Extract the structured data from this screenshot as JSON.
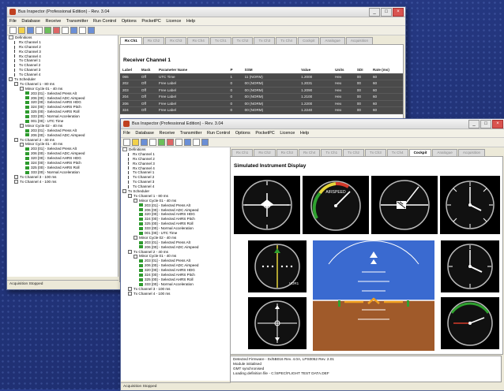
{
  "app_title": "Bus Inspector (Professional Edition) - Rev. 3.04",
  "menu": [
    "File",
    "Database",
    "Receive",
    "Transmitter",
    "Run Control",
    "Options",
    "PocketPC",
    "Licence",
    "Help"
  ],
  "tabs": [
    "Rx Ch1",
    "Rx Ch2",
    "Rx Ch3",
    "Rx Ch4",
    "Tx Ch1",
    "Tx Ch2",
    "Tx Ch3",
    "Tx Ch4",
    "Cockpit",
    "Analogue",
    "Acquisition"
  ],
  "back_window": {
    "receiver_heading": "Receiver Channel 1",
    "columns": [
      "Label",
      "Mask",
      "Parameter Name",
      "P",
      "SSM",
      "Value",
      "Units",
      "SDI",
      "Rate (ms)"
    ],
    "rows": [
      [
        "065",
        "Off",
        "UTC Time",
        "1",
        "11 (NORM)",
        "1.2000",
        "Hex",
        "00",
        "60"
      ],
      [
        "202",
        "Off",
        "Free Label",
        "0",
        "00 (NORM)",
        "1.2031",
        "Hex",
        "00",
        "60"
      ],
      [
        "203",
        "Off",
        "Free Label",
        "0",
        "00 (NORM)",
        "1.2090",
        "Hex",
        "00",
        "60"
      ],
      [
        "204",
        "Off",
        "Free Label",
        "0",
        "00 (NORM)",
        "1.2100",
        "Hex",
        "00",
        "60"
      ],
      [
        "206",
        "Off",
        "Free Label",
        "0",
        "00 (NORM)",
        "1.2200",
        "Hex",
        "00",
        "60"
      ],
      [
        "324",
        "Off",
        "Free Label",
        "0",
        "00 (NORM)",
        "1.2240",
        "Hex",
        "00",
        "60"
      ]
    ],
    "status": "Acquisition Stopped"
  },
  "tree": [
    {
      "level": 0,
      "icon": "doc",
      "label": "Definitions"
    },
    {
      "level": 1,
      "icon": "ant",
      "label": "Rx Channel 1"
    },
    {
      "level": 1,
      "icon": "ant",
      "label": "Rx Channel 2"
    },
    {
      "level": 1,
      "icon": "ant",
      "label": "Rx Channel 3"
    },
    {
      "level": 1,
      "icon": "ant",
      "label": "Rx Channel 4"
    },
    {
      "level": 1,
      "icon": "ant",
      "label": "Tx Channel 1"
    },
    {
      "level": 1,
      "icon": "ant",
      "label": "Tx Channel 2"
    },
    {
      "level": 1,
      "icon": "ant",
      "label": "Tx Channel 3"
    },
    {
      "level": 1,
      "icon": "ant",
      "label": "Tx Channel 4"
    },
    {
      "level": 0,
      "icon": "box",
      "label": "Tx Scheduler"
    },
    {
      "level": 1,
      "icon": "box",
      "label": "Tx Channel 1 - 80 ms"
    },
    {
      "level": 2,
      "icon": "box",
      "label": "Minor Cycle 01 - 40 ms"
    },
    {
      "level": 3,
      "icon": "grn",
      "label": "203 [01] - Selected Press Alt"
    },
    {
      "level": 3,
      "icon": "grn",
      "label": "206 [00] - Selected ADC Airspeed"
    },
    {
      "level": 3,
      "icon": "grn",
      "label": "320 [00] - Selected AHRS HDG"
    },
    {
      "level": 3,
      "icon": "grn",
      "label": "324 [00] - Selected AHRS Pitch"
    },
    {
      "level": 3,
      "icon": "grn",
      "label": "325 [00] - Selected AHRS Roll"
    },
    {
      "level": 3,
      "icon": "grn",
      "label": "333 [00] - Normal Acceleration"
    },
    {
      "level": 3,
      "icon": "grn",
      "label": "001 [00] - UTC Time"
    },
    {
      "level": 2,
      "icon": "box",
      "label": "Minor Cycle 02 - 40 ms"
    },
    {
      "level": 3,
      "icon": "grn",
      "label": "203 [01] - Selected Press Alt"
    },
    {
      "level": 3,
      "icon": "grn",
      "label": "206 [00] - Selected ADC Airspeed"
    },
    {
      "level": 1,
      "icon": "box",
      "label": "Tx Channel 2 - 40 ms"
    },
    {
      "level": 2,
      "icon": "box",
      "label": "Minor Cycle 01 - 40 ms"
    },
    {
      "level": 3,
      "icon": "grn",
      "label": "203 [01] - Selected Press Alt"
    },
    {
      "level": 3,
      "icon": "grn",
      "label": "206 [00] - Selected ADC Airspeed"
    },
    {
      "level": 3,
      "icon": "grn",
      "label": "320 [00] - Selected AHRS HDG"
    },
    {
      "level": 3,
      "icon": "grn",
      "label": "324 [00] - Selected AHRS Pitch"
    },
    {
      "level": 3,
      "icon": "grn",
      "label": "325 [00] - Selected AHRS Roll"
    },
    {
      "level": 3,
      "icon": "grn",
      "label": "333 [00] - Normal Acceleration"
    },
    {
      "level": 1,
      "icon": "box",
      "label": "Tx Channel 3 - 100 ms"
    },
    {
      "level": 1,
      "icon": "box",
      "label": "Tx Channel 4 - 100 ms"
    }
  ],
  "front_window": {
    "panel_heading": "Simulated Instrument Display",
    "airspeed_label": "AIRSPEED",
    "vor_label": "VOR1",
    "log_lines": [
      "Detected Firmware - 0x/5B016 Rev. 4.0A, LPS0052 Rev. 2.01",
      "Module initialised",
      "GMT synchronised",
      "Loading definition file - C:\\SPEC\\FLIGHT TEST DATA.DEF"
    ],
    "status": "Acquisition Stopped"
  },
  "colors": {
    "desktop": "#22347a",
    "sky": "#3a6ad0",
    "ground": "#a05a2a",
    "rx_row_bg": "#4a4a4a",
    "active_item": "#2e9b2e"
  },
  "icons": [
    "app-icon",
    "minimize-icon",
    "maximize-icon",
    "close-icon",
    "new-file-icon",
    "open-folder-icon",
    "save-icon",
    "help-icon"
  ]
}
